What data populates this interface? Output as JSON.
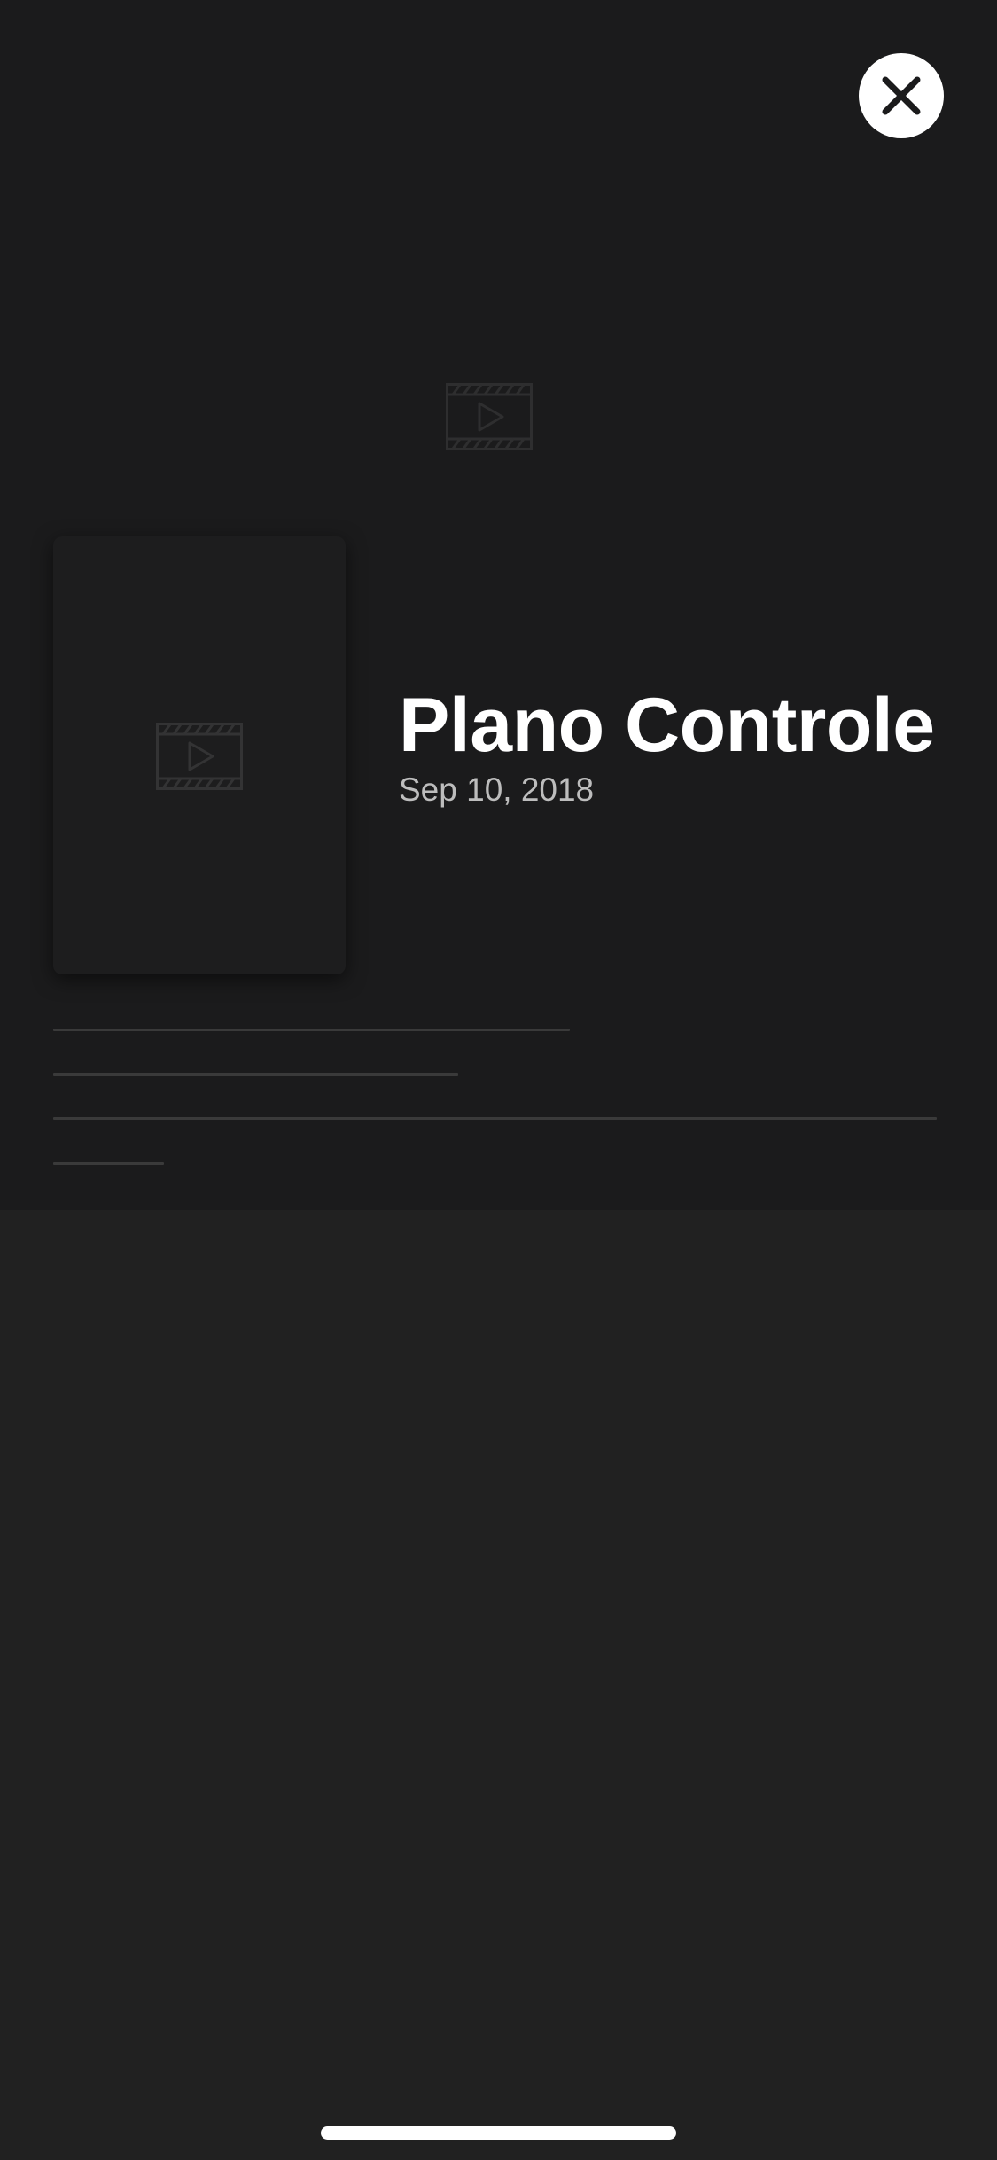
{
  "header": {
    "close_icon": "close-icon"
  },
  "hero": {
    "backdrop_icon": "film-play-icon",
    "poster_icon": "film-play-icon"
  },
  "detail": {
    "title": "Plano Controle",
    "date": "Sep 10, 2018"
  },
  "colors": {
    "background": "#212121",
    "hero_background": "#1b1b1c",
    "title": "#ffffff",
    "date": "#bdbdbd",
    "placeholder": "#3a3a3a"
  }
}
